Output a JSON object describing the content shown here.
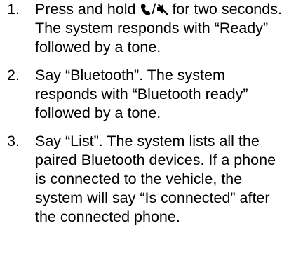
{
  "steps": [
    {
      "number": "1.",
      "before_icon": "Press and hold ",
      "icon_phone": "phone-handset-icon",
      "separator": " / ",
      "icon_mute": "mute-speaker-icon",
      "after_icon": " for two seconds. The system responds with “Ready” followed by a tone."
    },
    {
      "number": "2.",
      "text": "Say “Bluetooth”. The system responds with “Bluetooth ready” followed by a tone."
    },
    {
      "number": "3.",
      "text": "Say “List”. The system lists all the paired Bluetooth devices. If a phone is connected to the vehicle, the system will say “Is connected” after the connected phone."
    }
  ]
}
